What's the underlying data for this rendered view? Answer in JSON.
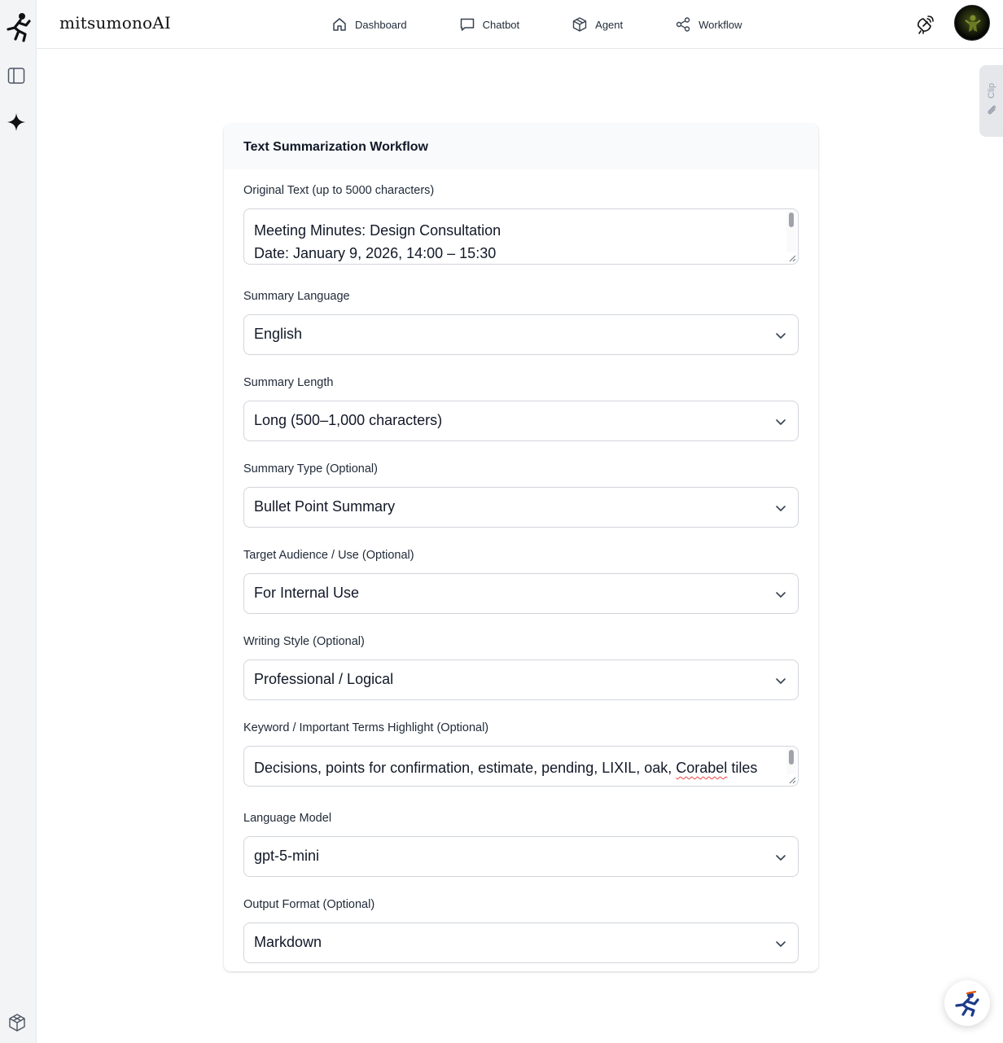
{
  "app": {
    "brand": "mitsumonoAI"
  },
  "nav": {
    "items": [
      {
        "label": "Dashboard",
        "icon": "home-icon"
      },
      {
        "label": "Chatbot",
        "icon": "chat-bubble-icon"
      },
      {
        "label": "Agent",
        "icon": "cube-icon"
      },
      {
        "label": "Workflow",
        "icon": "share-nodes-icon"
      }
    ]
  },
  "rail": {
    "icons": [
      "runner-logo-icon",
      "sidebar-panel-icon",
      "sparkle-icon",
      "box-icon"
    ]
  },
  "clip": {
    "label": "Clip",
    "icon": "paperclip-icon"
  },
  "card": {
    "title": "Text Summarization Workflow",
    "original_text": {
      "label": "Original Text (up to 5000 characters)",
      "line1": "Meeting Minutes: Design Consultation",
      "line2": "Date: January 9, 2026, 14:00 – 15:30"
    },
    "summary_language": {
      "label": "Summary Language",
      "value": "English"
    },
    "summary_length": {
      "label": "Summary Length",
      "value": "Long (500–1,000 characters)"
    },
    "summary_type": {
      "label": "Summary Type (Optional)",
      "value": "Bullet Point Summary"
    },
    "target_audience": {
      "label": "Target Audience / Use (Optional)",
      "value": "For Internal Use"
    },
    "writing_style": {
      "label": "Writing Style (Optional)",
      "value": "Professional / Logical"
    },
    "keywords": {
      "label": "Keyword / Important Terms Highlight (Optional)",
      "value_before": "Decisions, points for confirmation, estimate, pending, LIXIL, oak, ",
      "value_misspelled": "Corabel",
      "value_after": " tiles"
    },
    "language_model": {
      "label": "Language Model",
      "value": "gpt-5-mini"
    },
    "output_format": {
      "label": "Output Format (Optional)",
      "value": "Markdown"
    }
  },
  "colors": {
    "border": "#d1d5db",
    "card_header_bg": "#f8fafc",
    "rail_bg": "#f3f4f6",
    "fab_accent": "#1e3a8a",
    "fab_secondary": "#ea580c"
  }
}
